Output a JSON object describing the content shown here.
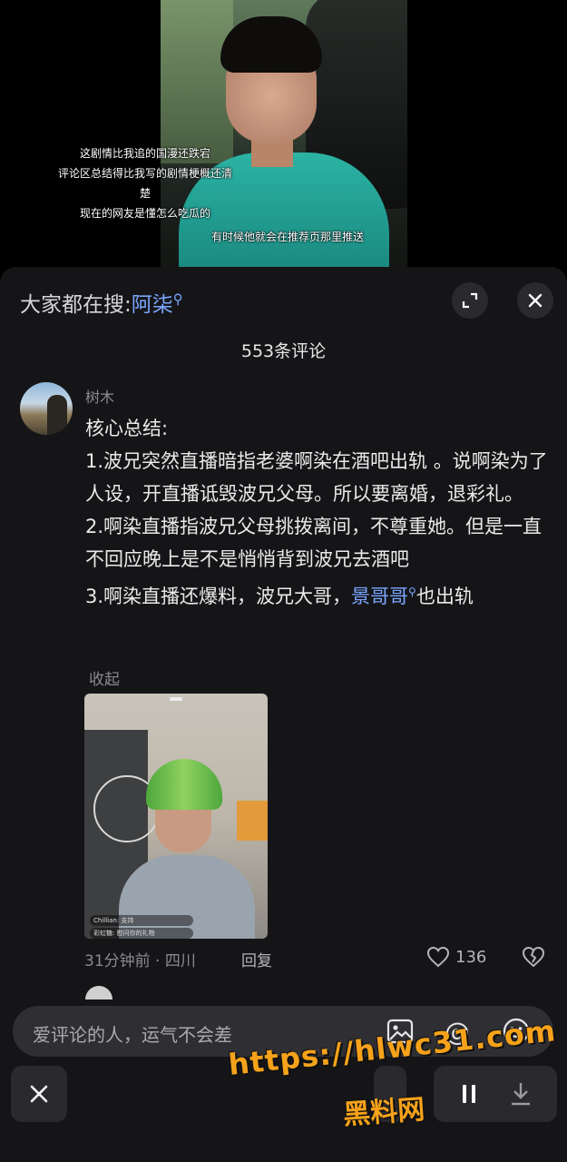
{
  "video": {
    "subtitles_left": [
      "这剧情比我追的国漫还跌宕",
      "评论区总结得比我写的剧情梗概还清",
      "楚",
      "现在的网友是懂怎么吃瓜的"
    ],
    "subtitle_right": "有时候他就会在推荐页那里推送"
  },
  "panel": {
    "search_prefix": "大家都在搜:",
    "search_keyword": "阿柒",
    "comment_count": "553条评论"
  },
  "comment": {
    "username": "树木",
    "lines": [
      "核心总结:",
      "1.波兄突然直播暗指老婆啊染在酒吧出轨 。说啊染为了人设，开直播诋毁波兄父母。所以要离婚，退彩礼。",
      "2.啊染直播指波兄父母挑拨离间，不尊重她。但是一直不回应晚上是不是悄悄背到波兄去酒吧"
    ],
    "line3_prefix": "3.啊染直播还爆料，波兄大哥，",
    "line3_link": "景哥哥",
    "line3_suffix": "也出轨",
    "collapse_label": "收起",
    "image_chat": [
      "Chillian: 支持",
      "彩虹糖: 慰问你的礼物"
    ],
    "time_location": "31分钟前 · 四川",
    "reply_label": "回复",
    "like_count": "136"
  },
  "input": {
    "placeholder": "爱评论的人，运气不会差"
  },
  "watermark": {
    "url": "https://hlwc31.com",
    "name": "黑料网"
  },
  "icons": {
    "search_hint": "search-icon",
    "expand": "expand-icon",
    "close": "close-icon",
    "like": "heart-icon",
    "dislike": "broken-heart-icon",
    "image": "image-icon",
    "at": "at-icon",
    "emoji": "emoji-icon",
    "pause": "pause-icon",
    "download": "download-icon"
  },
  "colors": {
    "panel_bg": "#151518",
    "link": "#7aa7ff",
    "watermark": "#f6a21a"
  }
}
